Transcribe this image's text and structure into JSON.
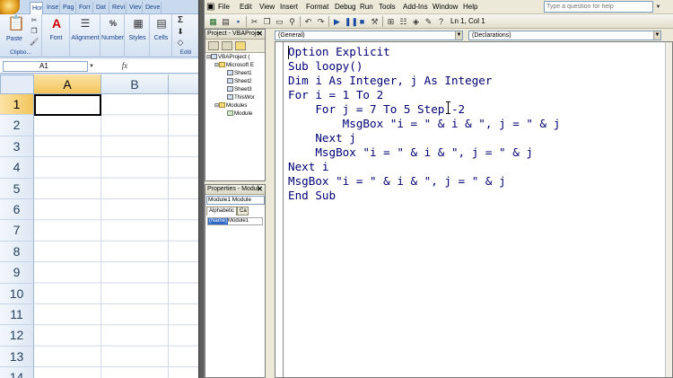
{
  "excel": {
    "tabs": [
      "Hor",
      "Inse",
      "Pag",
      "Forr",
      "Dat",
      "Revi",
      "Viev",
      "Deve"
    ],
    "ribbon": {
      "paste": "Paste",
      "clipboard": "Clipbo...",
      "font": "Font",
      "alignment": "Alignment",
      "number": "Number",
      "styles": "Styles",
      "cells": "Cells",
      "editing": "Editi",
      "number_icon": "%"
    },
    "name_box": "A1",
    "fx_label": "fx",
    "columns": [
      "A",
      "B"
    ],
    "rows": [
      "1",
      "2",
      "3",
      "4",
      "5",
      "6",
      "7",
      "8",
      "9",
      "10",
      "11",
      "12",
      "13",
      "14"
    ]
  },
  "vbe": {
    "menu": [
      "File",
      "Edit",
      "View",
      "Insert",
      "Format",
      "Debug",
      "Run",
      "Tools",
      "Add-Ins",
      "Window",
      "Help"
    ],
    "help_placeholder": "Type a question for help",
    "status": "Ln 1, Col 1",
    "project": {
      "title": "Project - VBAProje",
      "tree": [
        "VBAProject (",
        "Microsoft E",
        "Sheet1",
        "Sheet2",
        "Sheet3",
        "ThisWor",
        "Modules",
        "Module"
      ]
    },
    "properties": {
      "title": "Properties - Modul",
      "object": "Module1 Module",
      "tabs": [
        "Alphabetic",
        "Ca"
      ],
      "row_key": "(Name)",
      "row_value": "Module1"
    },
    "code": {
      "object_combo": "(General)",
      "proc_combo": "(Declarations)",
      "lines": [
        "Option Explicit",
        "Sub loopy()",
        "Dim i As Integer, j As Integer",
        "For i = 1 To 2",
        "    For j = 7 To 5 Step -2",
        "        MsgBox \"i = \" & i & \", j = \" & j",
        "    Next j",
        "    MsgBox \"i = \" & i & \", j = \" & j",
        "Next i",
        "MsgBox \"i = \" & i & \", j = \" & j",
        "End Sub"
      ]
    }
  }
}
